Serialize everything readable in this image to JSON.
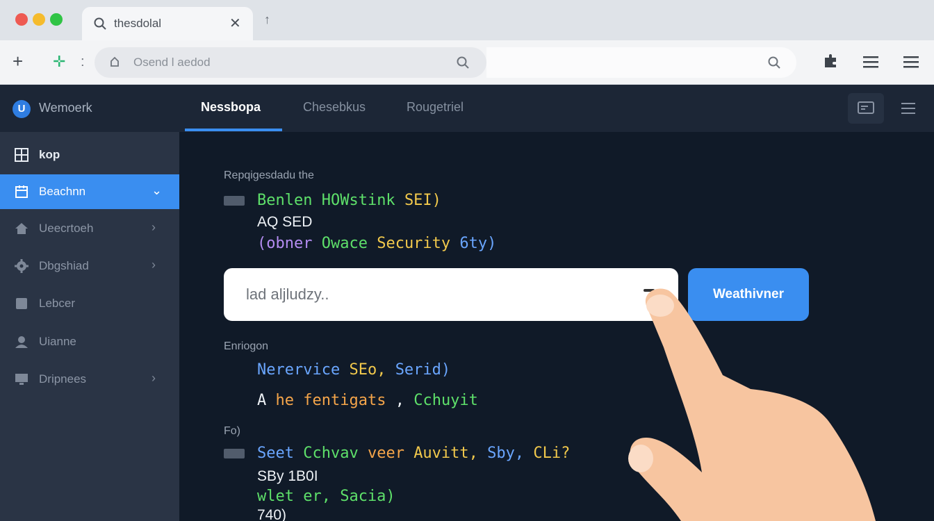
{
  "browser": {
    "tab_title": "thesdolal",
    "new_tab_glyph": "↑",
    "address_text": "Osend l aedod",
    "icons": [
      "search-icon",
      "close-icon",
      "plus-icon",
      "extension-icon",
      "lock-icon",
      "puzzle-icon",
      "list-icon",
      "menu-icon"
    ]
  },
  "app": {
    "brand": "Wemoerk",
    "brand_logo_glyph": "U",
    "sidebar": [
      {
        "label": "kop",
        "icon": "grid-icon",
        "state": "plain",
        "chevron": false
      },
      {
        "label": "Beachnn",
        "icon": "calendar-icon",
        "state": "active",
        "chevron": "down"
      },
      {
        "label": "Ueecrtoeh",
        "icon": "home-icon",
        "state": "normal",
        "chevron": "right"
      },
      {
        "label": "Dbgshiad",
        "icon": "gear-icon",
        "state": "normal",
        "chevron": "right"
      },
      {
        "label": "Lebcer",
        "icon": "square-icon",
        "state": "normal",
        "chevron": false
      },
      {
        "label": "Uianne",
        "icon": "user-icon",
        "state": "normal",
        "chevron": false
      },
      {
        "label": "Dripnees",
        "icon": "monitor-icon",
        "state": "normal",
        "chevron": "right"
      }
    ],
    "tabs": [
      {
        "label": "Nessbopa",
        "active": true
      },
      {
        "label": "Chesebkus",
        "active": false
      },
      {
        "label": "Rougetriel",
        "active": false
      }
    ]
  },
  "content": {
    "section1_label": "Repqigesdadu the",
    "code1": {
      "line1": [
        "Benlen ",
        "HOWstink ",
        "SEI)"
      ],
      "line2": "AQ SED",
      "line3": [
        "(obner ",
        "Owace ",
        "Security ",
        "6ty)"
      ]
    },
    "search": {
      "placeholder": "lad aljludzy..",
      "button_label": "Weathivner"
    },
    "section2_label": "Enriogon",
    "code2": {
      "line1": [
        "Nerervice ",
        "SEo, ",
        "Serid)"
      ],
      "line2": [
        "A ",
        "he ",
        "fentigats ",
        ", ",
        "Cchuyit"
      ]
    },
    "section3_label": "Fo)",
    "code3": {
      "line1": [
        "Seet ",
        "Cchvav ",
        "veer ",
        "Auvitt, ",
        "Sby, ",
        "CLi?"
      ],
      "line2": "SBy 1B0I",
      "line3": "wlet er, Sacia)",
      "line4": "740)"
    }
  },
  "colors": {
    "accent": "#3a8ef0",
    "sidebar_bg": "#2a3445",
    "content_bg": "#101a28",
    "hand": "#f7c5a0"
  }
}
